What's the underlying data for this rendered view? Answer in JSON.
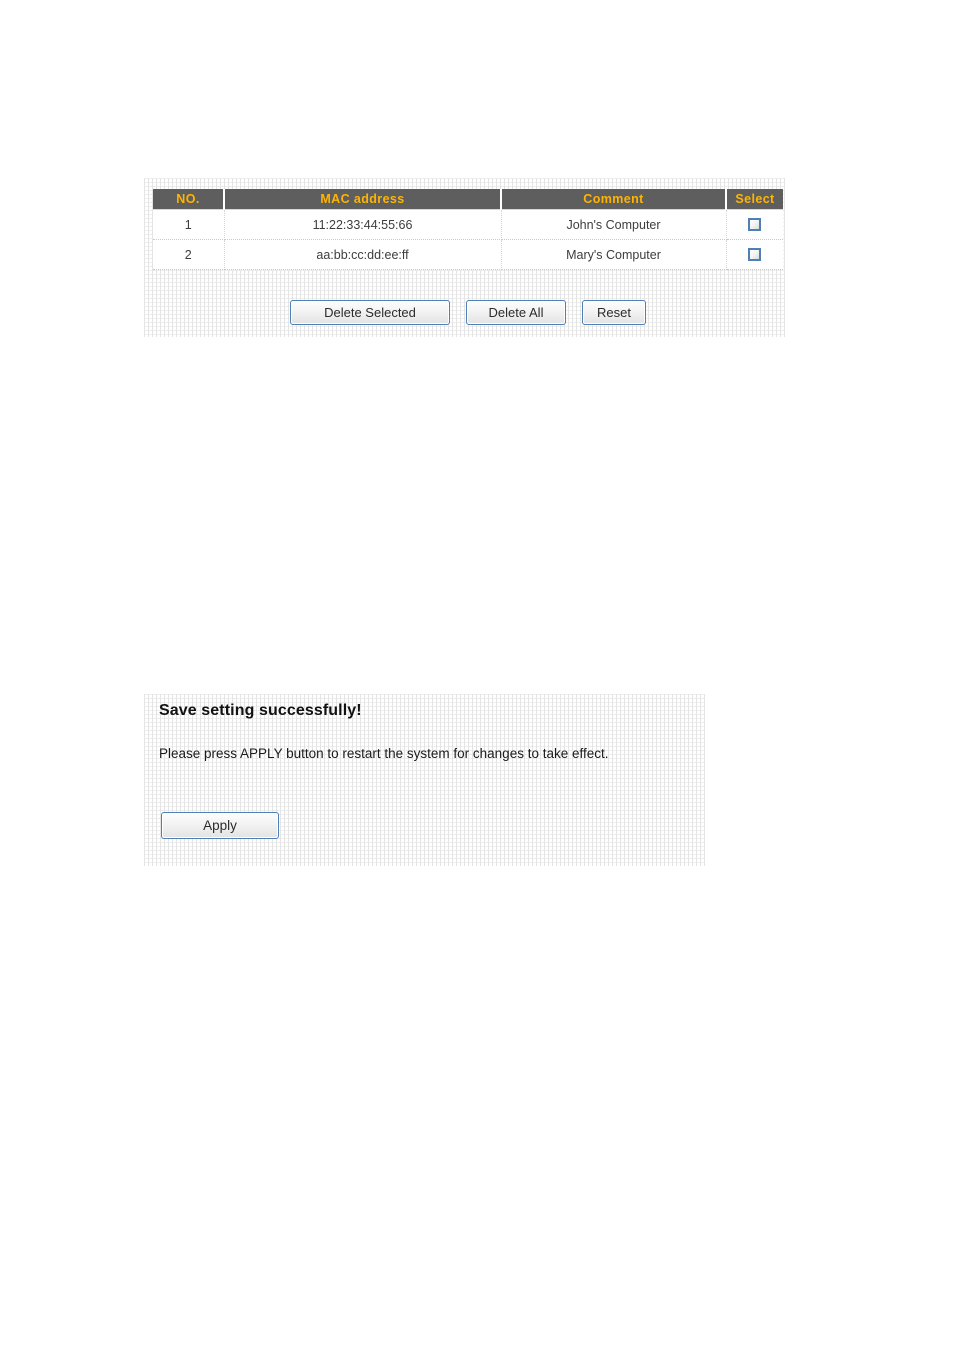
{
  "mac_filter_panel": {
    "table": {
      "columns": [
        {
          "key": "no",
          "label": "NO."
        },
        {
          "key": "mac",
          "label": "MAC address"
        },
        {
          "key": "comment",
          "label": "Comment"
        },
        {
          "key": "select",
          "label": "Select"
        }
      ],
      "rows": [
        {
          "no": "1",
          "mac": "11:22:33:44:55:66",
          "comment": "John's Computer",
          "selected": false,
          "checkbox_icon": "checkbox-unchecked-icon"
        },
        {
          "no": "2",
          "mac": "aa:bb:cc:dd:ee:ff",
          "comment": "Mary's Computer",
          "selected": false,
          "checkbox_icon": "checkbox-unchecked-icon"
        }
      ]
    },
    "buttons": {
      "delete_selected": "Delete Selected",
      "delete_all": "Delete All",
      "reset": "Reset"
    }
  },
  "save_panel": {
    "title": "Save setting successfully!",
    "message": "Please press APPLY button to restart the system for changes to take effect.",
    "apply_button": "Apply"
  },
  "colors": {
    "header_background": "#5e5e5e",
    "header_text": "#ffb400",
    "panel_background": "#ffffff",
    "panel_grid": "#e4e4e4",
    "button_border": "#4e7fb5",
    "checkbox_border": "#4e7fb5",
    "body_text": "#3d3d3d"
  }
}
